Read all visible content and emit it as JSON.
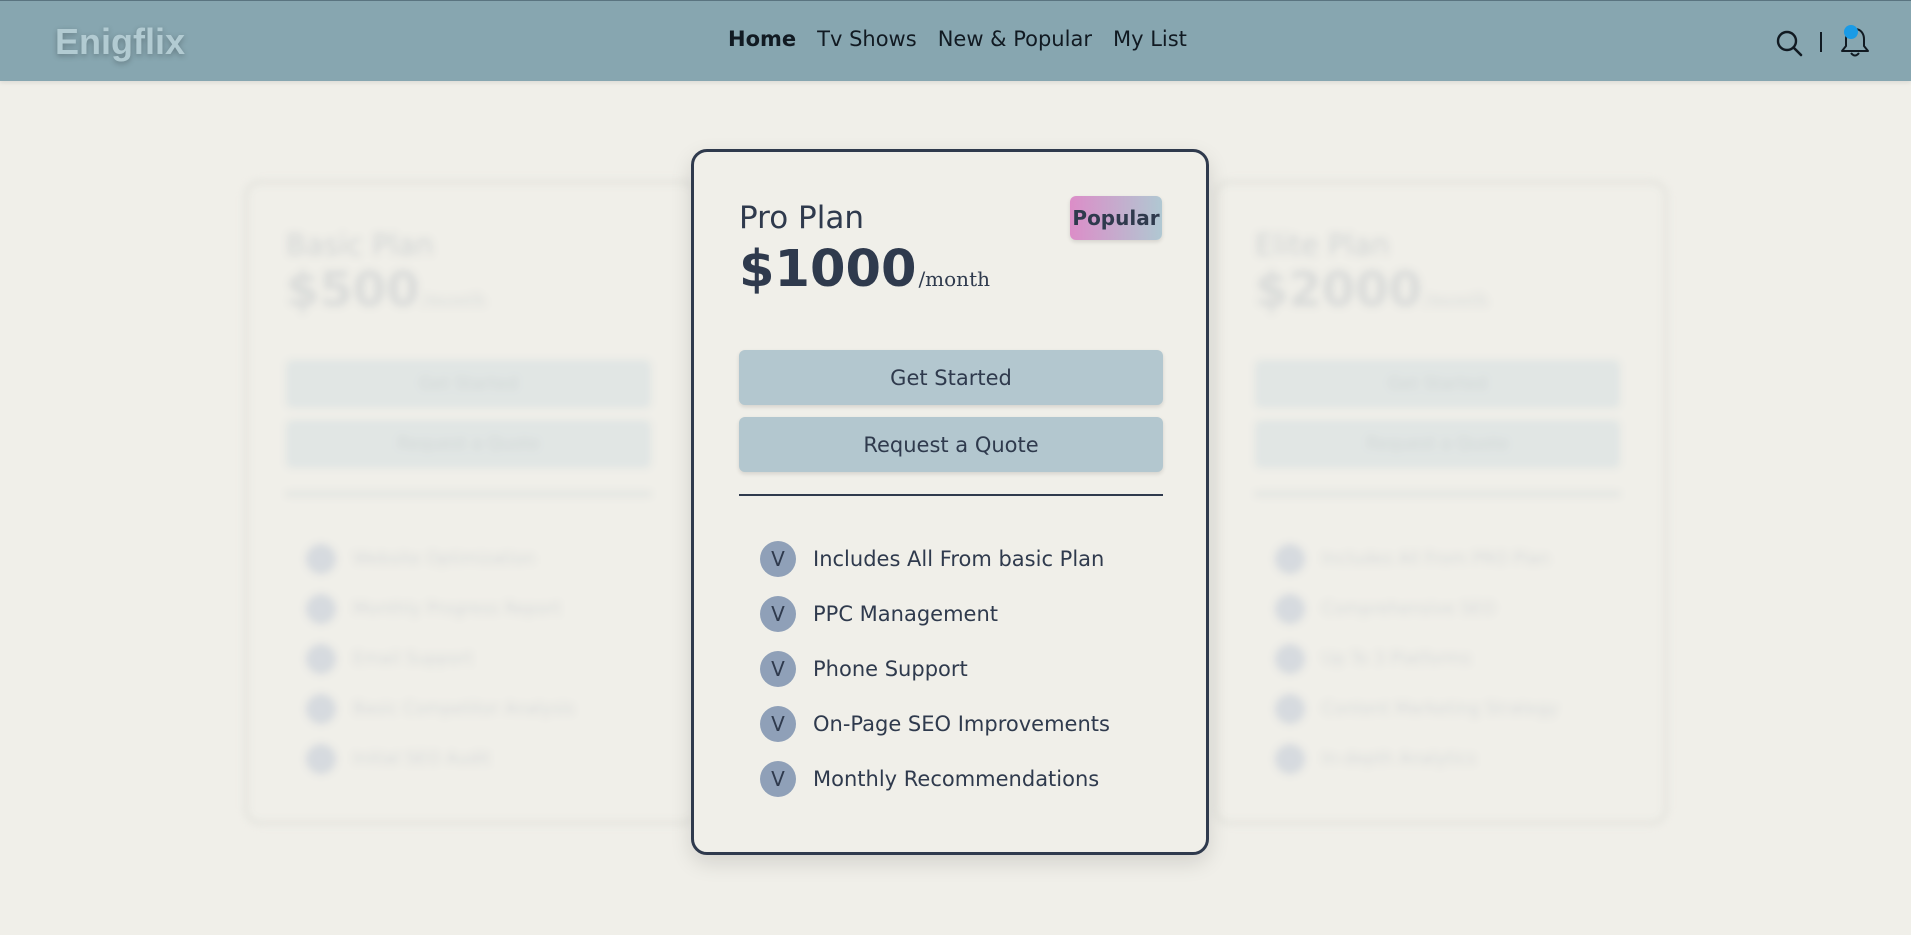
{
  "brand": "Enigflix",
  "nav": {
    "items": [
      {
        "label": "Home",
        "active": true
      },
      {
        "label": "Tv Shows",
        "active": false
      },
      {
        "label": "New & Popular",
        "active": false
      },
      {
        "label": "My List",
        "active": false
      }
    ],
    "separator": "|",
    "notification_dot_color": "#1a9be6"
  },
  "plans": {
    "basic": {
      "name": "Basic Plan",
      "price": "$500",
      "period": "/month",
      "get_started": "Get Started",
      "quote": "Request a Quote",
      "check": "V",
      "features": [
        "Website Optimization",
        "Monthly Progress Report",
        "Email Support",
        "Basic Competitor Analysis",
        "Initial SEO Audit"
      ]
    },
    "pro": {
      "name": "Pro Plan",
      "price": "$1000",
      "period": "/month",
      "badge": "Popular",
      "get_started": "Get Started",
      "quote": "Request a Quote",
      "check": "V",
      "features": [
        "Includes All From basic Plan",
        "PPC Management",
        "Phone Support",
        "On-Page SEO Improvements",
        "Monthly Recommendations"
      ]
    },
    "elite": {
      "name": "Elite Plan",
      "price": "$2000",
      "period": "/month",
      "get_started": "Get Started",
      "quote": "Request a Quote",
      "check": "V",
      "features": [
        "Includes All From PRO Plan",
        "Comprehensive SEO",
        "Up To 3 Platforms",
        "Content Marketing Strategy",
        "In-depth Analytics"
      ]
    }
  },
  "colors": {
    "header_bg": "#87a6b0",
    "page_bg": "#f0efe9",
    "button_bg": "#b3c7cf",
    "text": "#2f3a4d",
    "check_bg": "#8fa0b8"
  }
}
